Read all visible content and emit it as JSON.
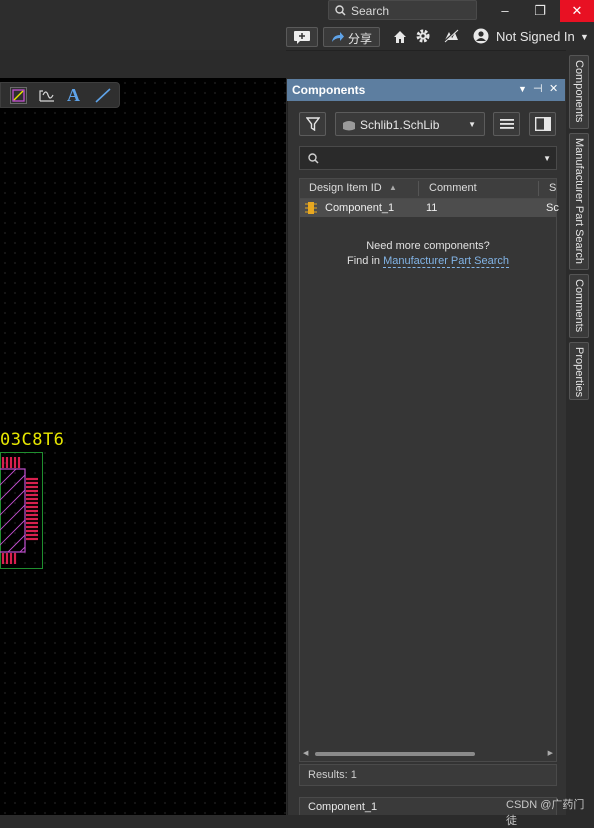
{
  "titlebar": {
    "search_placeholder": "Search",
    "minimize": "–",
    "maximize": "❐",
    "close": "✕"
  },
  "toolbar": {
    "share_label": "分享",
    "account_label": "Not Signed In"
  },
  "canvas": {
    "part_label": "03C8T6"
  },
  "panel": {
    "title": "Components",
    "library_select": "Schlib1.SchLib",
    "search_placeholder": "",
    "columns": [
      "Design Item ID",
      "Comment",
      "S"
    ],
    "rows": [
      {
        "design_item_id": "Component_1",
        "comment": "11",
        "s": "Sc"
      }
    ],
    "need_more_line1": "Need more components?",
    "need_more_prefix": "Find in ",
    "need_more_link": "Manufacturer Part Search",
    "results": "Results: 1",
    "selected_component": "Component_1"
  },
  "dock_tabs": [
    "Components",
    "Manufacturer Part Search",
    "Comments",
    "Properties"
  ],
  "watermark": "CSDN @广药门徒",
  "colors": {
    "panel_header": "#5d7ea0",
    "canvas_bg": "#000000",
    "part_label": "#e6e600",
    "link": "#82b4e6",
    "close_button": "#e81123"
  }
}
